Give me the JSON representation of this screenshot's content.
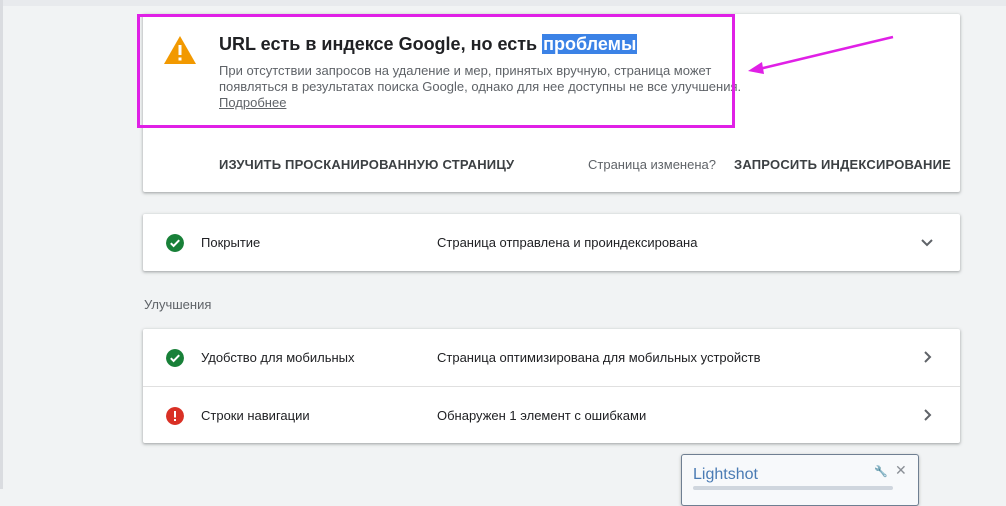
{
  "status": {
    "title_main": "URL есть в индексе Google, но есть",
    "title_highlight": "проблемы",
    "description": "При отсутствии запросов на удаление и мер, принятых вручную, страница может появляться в результатах поиска Google, однако для нее доступны не все улучшения.",
    "learn_more": "Подробнее",
    "inspect_crawled": "ИЗУЧИТЬ ПРОСКАНИРОВАННУЮ СТРАНИЦУ",
    "page_changed": "Страница изменена?",
    "request_indexing": "ЗАПРОСИТЬ ИНДЕКСИРОВАНИЕ"
  },
  "coverage": {
    "label": "Покрытие",
    "value": "Страница отправлена и проиндексирована",
    "icon": "check-circle-icon"
  },
  "enhancements": {
    "section_label": "Улучшения",
    "items": [
      {
        "label": "Удобство для мобильных",
        "value": "Страница оптимизирована для мобильных устройств",
        "icon": "check-circle-icon"
      },
      {
        "label": "Строки навигации",
        "value": "Обнаружен 1 элемент с ошибками",
        "icon": "error-circle-icon"
      }
    ]
  },
  "lightshot": {
    "title": "Lightshot"
  },
  "colors": {
    "ok": "#188038",
    "error": "#d93025",
    "warning": "#f29900",
    "annotation": "#e020e6"
  }
}
